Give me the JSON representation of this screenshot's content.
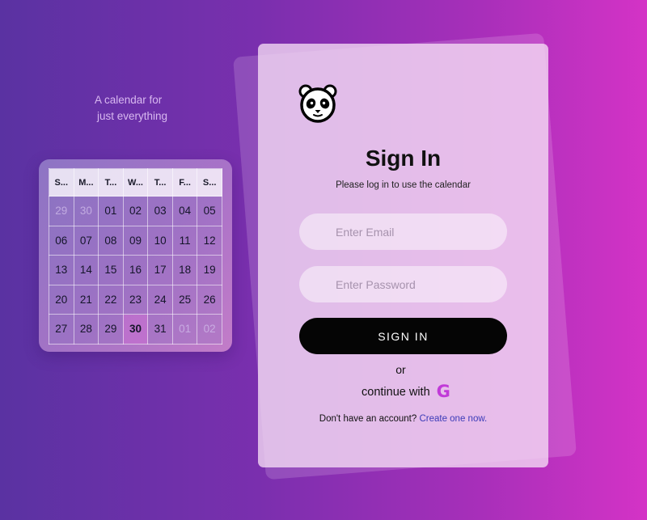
{
  "tagline": {
    "line1": "A calendar for",
    "line2": "just everything"
  },
  "calendar": {
    "weekdays": [
      "S...",
      "M...",
      "T...",
      "W...",
      "T...",
      "F...",
      "S..."
    ],
    "weeks": [
      [
        "29",
        "30",
        "01",
        "02",
        "03",
        "04",
        "05"
      ],
      [
        "06",
        "07",
        "08",
        "09",
        "10",
        "11",
        "12"
      ],
      [
        "13",
        "14",
        "15",
        "16",
        "17",
        "18",
        "19"
      ],
      [
        "20",
        "21",
        "22",
        "23",
        "24",
        "25",
        "26"
      ],
      [
        "27",
        "28",
        "29",
        "30",
        "31",
        "01",
        "02"
      ]
    ],
    "today": "30"
  },
  "signin": {
    "title": "Sign In",
    "subtitle": "Please log in to use the calendar",
    "email_placeholder": "Enter Email",
    "password_placeholder": "Enter Password",
    "button_label": "SIGN IN",
    "or_text": "or",
    "continue_text": "continue with",
    "google_icon": "G",
    "no_account_text": "Don't have an account?",
    "create_link": "Create one now."
  },
  "colors": {
    "accent": "#c13ad8",
    "link": "#3b3bb8",
    "button": "#050505"
  }
}
